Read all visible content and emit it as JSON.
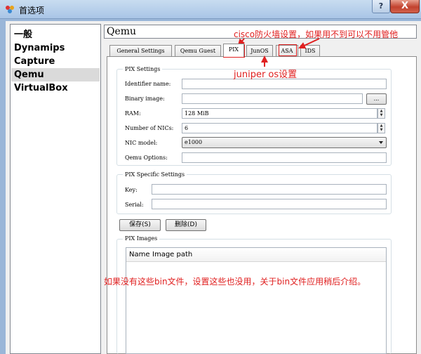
{
  "window": {
    "title": "首选项",
    "help_glyph": "?",
    "close_glyph": "X"
  },
  "categories": [
    "一般",
    "Dynamips",
    "Capture",
    "Qemu",
    "VirtualBox"
  ],
  "selected_category": "Qemu",
  "panel_title": "Qemu",
  "tabs": [
    "General Settings",
    "Qemu Guest",
    "PIX",
    "JunOS",
    "ASA",
    "IDS"
  ],
  "active_tab": "PIX",
  "pix_settings": {
    "title": "PIX Settings",
    "identifier_label": "Identifier name:",
    "identifier_value": "",
    "binary_label": "Binary image:",
    "binary_value": "",
    "browse_label": "...",
    "ram_label": "RAM:",
    "ram_value": "128 MiB",
    "nics_label": "Number of NICs:",
    "nics_value": "6",
    "nic_model_label": "NIC model:",
    "nic_model_value": "e1000",
    "qemu_options_label": "Qemu Options:",
    "qemu_options_value": ""
  },
  "pix_specific": {
    "title": "PIX Specific Settings",
    "key_label": "Key:",
    "key_value": "",
    "serial_label": "Serial:",
    "serial_value": ""
  },
  "buttons": {
    "save": "保存(S)",
    "delete": "删除(D)"
  },
  "pix_images": {
    "title": "PIX Images",
    "columns": [
      "Name",
      "Image path"
    ]
  },
  "annotations": {
    "cisco": "cisco防火墙设置，如果用不到可以不用管他",
    "juniper": "juniper os设置",
    "bin": "如果没有这些bin文件，设置这些也没用，关于bin文件应用稍后介绍。",
    "color": "#e02020"
  }
}
